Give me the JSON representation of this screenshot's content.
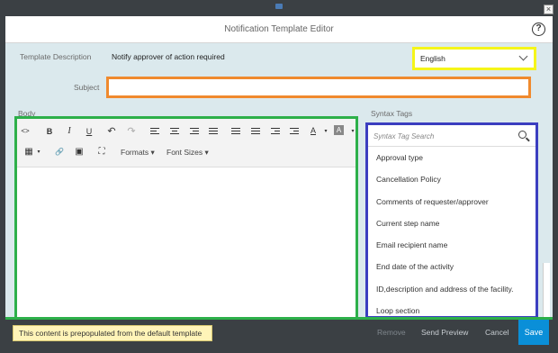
{
  "window": {
    "close_glyph": "×"
  },
  "dialog": {
    "title": "Notification Template Editor",
    "help_glyph": "?"
  },
  "form": {
    "template_description_label": "Template Description",
    "template_description_value": "Notify approver of action required",
    "language_selected": "English",
    "subject_label": "Subject",
    "subject_value": "",
    "body_label": "Body",
    "syntax_tags_label": "Syntax Tags"
  },
  "editor": {
    "toolbar": {
      "source": "<>",
      "bold": "B",
      "italic": "I",
      "underline": "U",
      "undo": "↶",
      "redo": "↷",
      "text_color": "A",
      "bg_color": "A",
      "table_glyph": "▦",
      "table_caret": "▾",
      "link": "🔗",
      "image": "▣",
      "fullscreen": "⛶",
      "formats": "Formats ▾",
      "font_sizes": "Font Sizes ▾"
    },
    "content": ""
  },
  "syntax_tags": {
    "search_placeholder": "Syntax Tag Search",
    "items": [
      "Approval type",
      "Cancellation Policy",
      "Comments of requester/approver",
      "Current step name",
      "Email recipient name",
      "End date of the activity",
      "ID,description and address of the facility.",
      "Loop section"
    ]
  },
  "footer": {
    "notice": "This content is prepopulated from the default template",
    "remove": "Remove",
    "send_preview": "Send Preview",
    "cancel": "Cancel",
    "save": "Save"
  },
  "colors": {
    "language_highlight": "#f5f51a",
    "subject_highlight": "#f08a2e",
    "editor_highlight": "#2db04a",
    "tags_highlight": "#3b3ec0",
    "save_button": "#0a8fd8",
    "dialog_background": "#dbe9ed"
  }
}
